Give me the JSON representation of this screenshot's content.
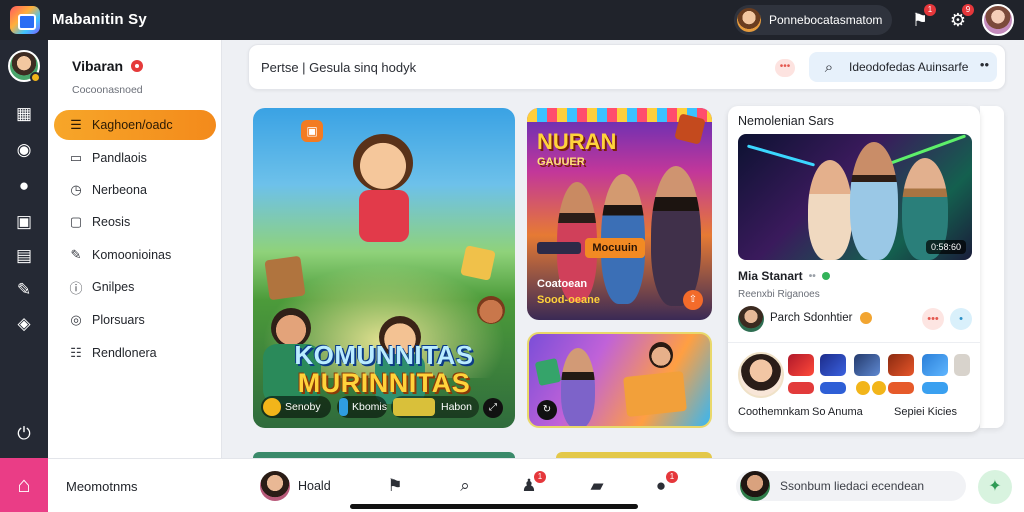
{
  "app": {
    "title": "Mabanitin Sy"
  },
  "topbar": {
    "account_label": "Ponnebocatasmatom",
    "badge_flag": "1",
    "badge_gear": "9"
  },
  "sidebar": {
    "title": "Vibaran",
    "subtitle": "Cocoonasnoed",
    "items": [
      {
        "label": "Kaghoen/oadc",
        "icon": "list-icon"
      },
      {
        "label": "Pandlaois",
        "icon": "folder-icon"
      },
      {
        "label": "Nerbeona",
        "icon": "clock-icon"
      },
      {
        "label": "Reosis",
        "icon": "box-icon"
      },
      {
        "label": "Komoonioinas",
        "icon": "edit-icon"
      },
      {
        "label": "Gnilpes",
        "icon": "info-icon"
      },
      {
        "label": "Plorsuars",
        "icon": "target-icon"
      },
      {
        "label": "Rendlonera",
        "icon": "doc-icon"
      }
    ]
  },
  "header": {
    "breadcrumb": "Pertse | Gesula sinq hodyk",
    "search_placeholder": "Ideodofedas Auinsarfe"
  },
  "feature": {
    "title_line1": "KOMUNNITAS",
    "title_line2": "MURINNITAS",
    "pill1": "Senoby",
    "pill2": "Kbomis",
    "pill3": "Habon"
  },
  "card2": {
    "headline": "NURAN",
    "headline_sub": "GAUUER",
    "sign": "Mocuuin",
    "caption1": "Coatoean",
    "caption2": "Sood-oeane"
  },
  "panel": {
    "title": "Nemolenian Sars",
    "duration": "0:58:60",
    "person_name": "Mia Stanart",
    "person_sub": "Reenxbi Riganoes",
    "author": "Parch Sdonhtier",
    "footer_left": "Coothemnkam",
    "footer_mid": "So Anuma",
    "footer_right": "Sepiei Kicies"
  },
  "bottombar": {
    "section_label": "Meomotnms",
    "user_name": "Hoald",
    "composer_placeholder": "Ssonbum liedaci ecendean",
    "badge_people": "1",
    "badge_chat": "1"
  },
  "colors": {
    "accent_orange": "#f7a629",
    "topbar_bg": "#20232b",
    "rail_bg": "#252934",
    "home_pink": "#ea3d86"
  }
}
